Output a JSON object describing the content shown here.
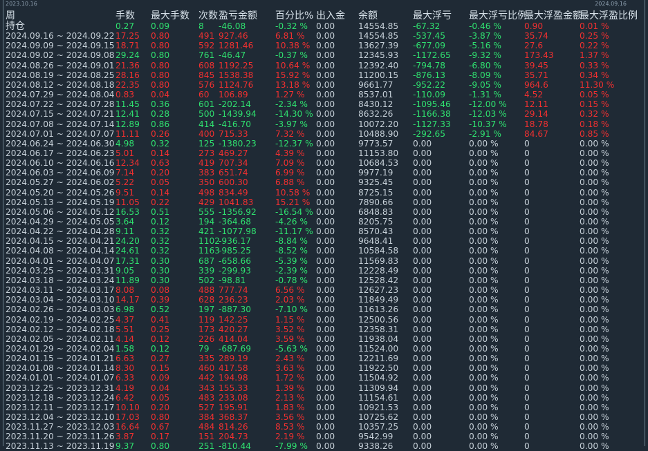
{
  "corner": {
    "left_date": "2023.10.16",
    "right_date": "2024.09.16"
  },
  "header": [
    "周",
    "手数",
    "最大手数",
    "次数",
    "盈亏金额",
    "百分比%",
    "出入金",
    "余额",
    "最大浮亏",
    "最大浮亏比例",
    "最大浮盈金额",
    "最大浮盈比例"
  ],
  "rows": [
    [
      "持仓",
      "0.27",
      "0.09",
      "8",
      "-46.08",
      "-0.32 %",
      "0.00",
      "14554.85",
      "-67.32",
      "-0.46 %",
      "0.90",
      "0.01 %"
    ],
    [
      "2024.09.16 ~ 2024.09.22",
      "17.25",
      "0.80",
      "491",
      "927.46",
      "6.81 %",
      "0.00",
      "14554.85",
      "-537.45",
      "-3.87 %",
      "35.74",
      "0.25 %"
    ],
    [
      "2024.09.09 ~ 2024.09.15",
      "18.71",
      "0.80",
      "592",
      "1281.46",
      "10.38 %",
      "0.00",
      "13627.39",
      "-677.09",
      "-5.16 %",
      "27.6",
      "0.22 %"
    ],
    [
      "2024.09.02 ~ 2024.09.08",
      "29.24",
      "0.80",
      "761",
      "-46.47",
      "-0.37 %",
      "0.00",
      "12345.93",
      "-1172.65",
      "-9.32 %",
      "173.43",
      "1.37 %"
    ],
    [
      "2024.08.26 ~ 2024.09.01",
      "21.36",
      "0.80",
      "608",
      "1192.25",
      "10.64 %",
      "0.00",
      "12392.40",
      "-794.78",
      "-6.80 %",
      "39.45",
      "0.33 %"
    ],
    [
      "2024.08.19 ~ 2024.08.25",
      "28.16",
      "0.80",
      "845",
      "1538.38",
      "15.92 %",
      "0.00",
      "11200.15",
      "-876.13",
      "-8.09 %",
      "35.71",
      "0.34 %"
    ],
    [
      "2024.08.12 ~ 2024.08.18",
      "22.35",
      "0.80",
      "576",
      "1124.76",
      "13.18 %",
      "0.00",
      "9661.77",
      "-952.22",
      "-9.05 %",
      "964.6",
      "11.30 %"
    ],
    [
      "2024.07.29 ~ 2024.08.04",
      "0.83",
      "0.04",
      "60",
      "106.89",
      "1.27 %",
      "0.00",
      "8537.01",
      "-110.09",
      "-1.31 %",
      "4.52",
      "0.05 %"
    ],
    [
      "2024.07.22 ~ 2024.07.28",
      "11.45",
      "0.36",
      "601",
      "-202.14",
      "-2.34 %",
      "0.00",
      "8430.12",
      "-1095.46",
      "-12.00 %",
      "12.11",
      "0.15 %"
    ],
    [
      "2024.07.15 ~ 2024.07.21",
      "12.41",
      "0.28",
      "500",
      "-1439.94",
      "-14.30 %",
      "0.00",
      "8632.26",
      "-1166.38",
      "-12.03 %",
      "29.14",
      "0.32 %"
    ],
    [
      "2024.07.08 ~ 2024.07.14",
      "12.89",
      "0.86",
      "414",
      "-416.70",
      "-3.97 %",
      "0.00",
      "10072.20",
      "-1127.33",
      "-10.37 %",
      "18.78",
      "0.18 %"
    ],
    [
      "2024.07.01 ~ 2024.07.07",
      "11.11",
      "0.26",
      "400",
      "715.33",
      "7.32 %",
      "0.00",
      "10488.90",
      "-292.65",
      "-2.91 %",
      "84.67",
      "0.85 %"
    ],
    [
      "2024.06.24 ~ 2024.06.30",
      "4.98",
      "0.32",
      "125",
      "-1380.23",
      "-12.37 %",
      "0.00",
      "9773.57",
      "0.00",
      "0.00 %",
      "0",
      "0.00 %"
    ],
    [
      "2024.06.17 ~ 2024.06.23",
      "5.01",
      "0.14",
      "273",
      "469.27",
      "4.39 %",
      "0.00",
      "11153.80",
      "0.00",
      "0.00 %",
      "0",
      "0.00 %"
    ],
    [
      "2024.06.10 ~ 2024.06.16",
      "12.34",
      "0.63",
      "419",
      "707.34",
      "7.09 %",
      "0.00",
      "10684.53",
      "0.00",
      "0.00 %",
      "0",
      "0.00 %"
    ],
    [
      "2024.06.03 ~ 2024.06.09",
      "7.14",
      "0.20",
      "383",
      "651.74",
      "6.99 %",
      "0.00",
      "9977.19",
      "0.00",
      "0.00 %",
      "0",
      "0.00 %"
    ],
    [
      "2024.05.27 ~ 2024.06.02",
      "5.22",
      "0.05",
      "350",
      "600.30",
      "6.88 %",
      "0.00",
      "9325.45",
      "0.00",
      "0.00 %",
      "0",
      "0.00 %"
    ],
    [
      "2024.05.20 ~ 2024.05.26",
      "9.51",
      "0.14",
      "498",
      "834.49",
      "10.58 %",
      "0.00",
      "8725.15",
      "0.00",
      "0.00 %",
      "0",
      "0.00 %"
    ],
    [
      "2024.05.13 ~ 2024.05.19",
      "11.05",
      "0.22",
      "429",
      "1041.83",
      "15.21 %",
      "0.00",
      "7890.66",
      "0.00",
      "0.00 %",
      "0",
      "0.00 %"
    ],
    [
      "2024.05.06 ~ 2024.05.12",
      "16.53",
      "0.51",
      "555",
      "-1356.92",
      "-16.54 %",
      "0.00",
      "6848.83",
      "0.00",
      "0.00 %",
      "0",
      "0.00 %"
    ],
    [
      "2024.04.29 ~ 2024.05.05",
      "3.64",
      "0.12",
      "194",
      "-364.68",
      "-4.26 %",
      "0.00",
      "8205.75",
      "0.00",
      "0.00 %",
      "0",
      "0.00 %"
    ],
    [
      "2024.04.22 ~ 2024.04.28",
      "9.11",
      "0.32",
      "421",
      "-1077.98",
      "-11.17 %",
      "0.00",
      "8570.43",
      "0.00",
      "0.00 %",
      "0",
      "0.00 %"
    ],
    [
      "2024.04.15 ~ 2024.04.21",
      "24.20",
      "0.32",
      "1102",
      "-936.17",
      "-8.84 %",
      "0.00",
      "9648.41",
      "0.00",
      "0.00 %",
      "0",
      "0.00 %"
    ],
    [
      "2024.04.08 ~ 2024.04.14",
      "24.61",
      "0.32",
      "1163",
      "-985.25",
      "-8.52 %",
      "0.00",
      "10584.58",
      "0.00",
      "0.00 %",
      "0",
      "0.00 %"
    ],
    [
      "2024.04.01 ~ 2024.04.07",
      "17.31",
      "0.30",
      "687",
      "-658.66",
      "-5.39 %",
      "0.00",
      "11569.83",
      "0.00",
      "0.00 %",
      "0",
      "0.00 %"
    ],
    [
      "2024.03.25 ~ 2024.03.31",
      "9.05",
      "0.30",
      "339",
      "-299.93",
      "-2.39 %",
      "0.00",
      "12228.49",
      "0.00",
      "0.00 %",
      "0",
      "0.00 %"
    ],
    [
      "2024.03.18 ~ 2024.03.24",
      "11.89",
      "0.30",
      "502",
      "-98.81",
      "-0.78 %",
      "0.00",
      "12528.42",
      "0.00",
      "0.00 %",
      "0",
      "0.00 %"
    ],
    [
      "2024.03.11 ~ 2024.03.17",
      "8.08",
      "0.08",
      "488",
      "777.74",
      "6.56 %",
      "0.00",
      "12627.23",
      "0.00",
      "0.00 %",
      "0",
      "0.00 %"
    ],
    [
      "2024.03.04 ~ 2024.03.10",
      "14.17",
      "0.39",
      "628",
      "236.23",
      "2.03 %",
      "0.00",
      "11849.49",
      "0.00",
      "0.00 %",
      "0",
      "0.00 %"
    ],
    [
      "2024.02.26 ~ 2024.03.03",
      "6.98",
      "0.52",
      "197",
      "-887.30",
      "-7.10 %",
      "0.00",
      "11613.26",
      "0.00",
      "0.00 %",
      "0",
      "0.00 %"
    ],
    [
      "2024.02.19 ~ 2024.02.25",
      "4.37",
      "0.41",
      "119",
      "142.25",
      "1.15 %",
      "0.00",
      "12500.56",
      "0.00",
      "0.00 %",
      "0",
      "0.00 %"
    ],
    [
      "2024.02.12 ~ 2024.02.18",
      "5.51",
      "0.25",
      "173",
      "420.27",
      "3.52 %",
      "0.00",
      "12358.31",
      "0.00",
      "0.00 %",
      "0",
      "0.00 %"
    ],
    [
      "2024.02.05 ~ 2024.02.11",
      "4.14",
      "0.12",
      "226",
      "414.04",
      "3.59 %",
      "0.00",
      "11938.04",
      "0.00",
      "0.00 %",
      "0",
      "0.00 %"
    ],
    [
      "2024.01.29 ~ 2024.02.04",
      "1.58",
      "0.12",
      "79",
      "-687.69",
      "-5.63 %",
      "0.00",
      "11524.00",
      "0.00",
      "0.00 %",
      "0",
      "0.00 %"
    ],
    [
      "2024.01.15 ~ 2024.01.21",
      "6.63",
      "0.27",
      "335",
      "289.19",
      "2.43 %",
      "0.00",
      "12211.69",
      "0.00",
      "0.00 %",
      "0",
      "0.00 %"
    ],
    [
      "2024.01.08 ~ 2024.01.14",
      "8.30",
      "0.15",
      "460",
      "417.58",
      "3.63 %",
      "0.00",
      "11922.50",
      "0.00",
      "0.00 %",
      "0",
      "0.00 %"
    ],
    [
      "2024.01.01 ~ 2024.01.07",
      "6.33",
      "0.09",
      "442",
      "194.98",
      "1.72 %",
      "0.00",
      "11504.92",
      "0.00",
      "0.00 %",
      "0",
      "0.00 %"
    ],
    [
      "2023.12.25 ~ 2023.12.31",
      "4.19",
      "0.04",
      "343",
      "155.33",
      "1.39 %",
      "0.00",
      "11309.94",
      "0.00",
      "0.00 %",
      "0",
      "0.00 %"
    ],
    [
      "2023.12.18 ~ 2023.12.24",
      "6.42",
      "0.05",
      "483",
      "233.08",
      "2.13 %",
      "0.00",
      "11154.61",
      "0.00",
      "0.00 %",
      "0",
      "0.00 %"
    ],
    [
      "2023.12.11 ~ 2023.12.17",
      "10.10",
      "0.20",
      "527",
      "195.91",
      "1.83 %",
      "0.00",
      "10921.53",
      "0.00",
      "0.00 %",
      "0",
      "0.00 %"
    ],
    [
      "2023.12.04 ~ 2023.12.10",
      "17.03",
      "0.80",
      "384",
      "368.37",
      "3.56 %",
      "0.00",
      "10725.62",
      "0.00",
      "0.00 %",
      "0",
      "0.00 %"
    ],
    [
      "2023.11.27 ~ 2023.12.03",
      "16.64",
      "0.67",
      "484",
      "814.26",
      "8.53 %",
      "0.00",
      "10357.25",
      "0.00",
      "0.00 %",
      "0",
      "0.00 %"
    ],
    [
      "2023.11.20 ~ 2023.11.26",
      "3.87",
      "0.17",
      "151",
      "204.73",
      "2.19 %",
      "0.00",
      "9542.99",
      "0.00",
      "0.00 %",
      "0",
      "0.00 %"
    ],
    [
      "2023.11.13 ~ 2023.11.19",
      "9.37",
      "0.80",
      "251",
      "-810.44",
      "-7.99 %",
      "0.00",
      "9338.26",
      "0.00",
      "0.00 %",
      "0",
      "0.00 %"
    ]
  ],
  "colors": {
    "background": "#1f2a35",
    "positive": "#2fe06f",
    "negative": "#f03030",
    "neutral": "#c6d0d8"
  }
}
